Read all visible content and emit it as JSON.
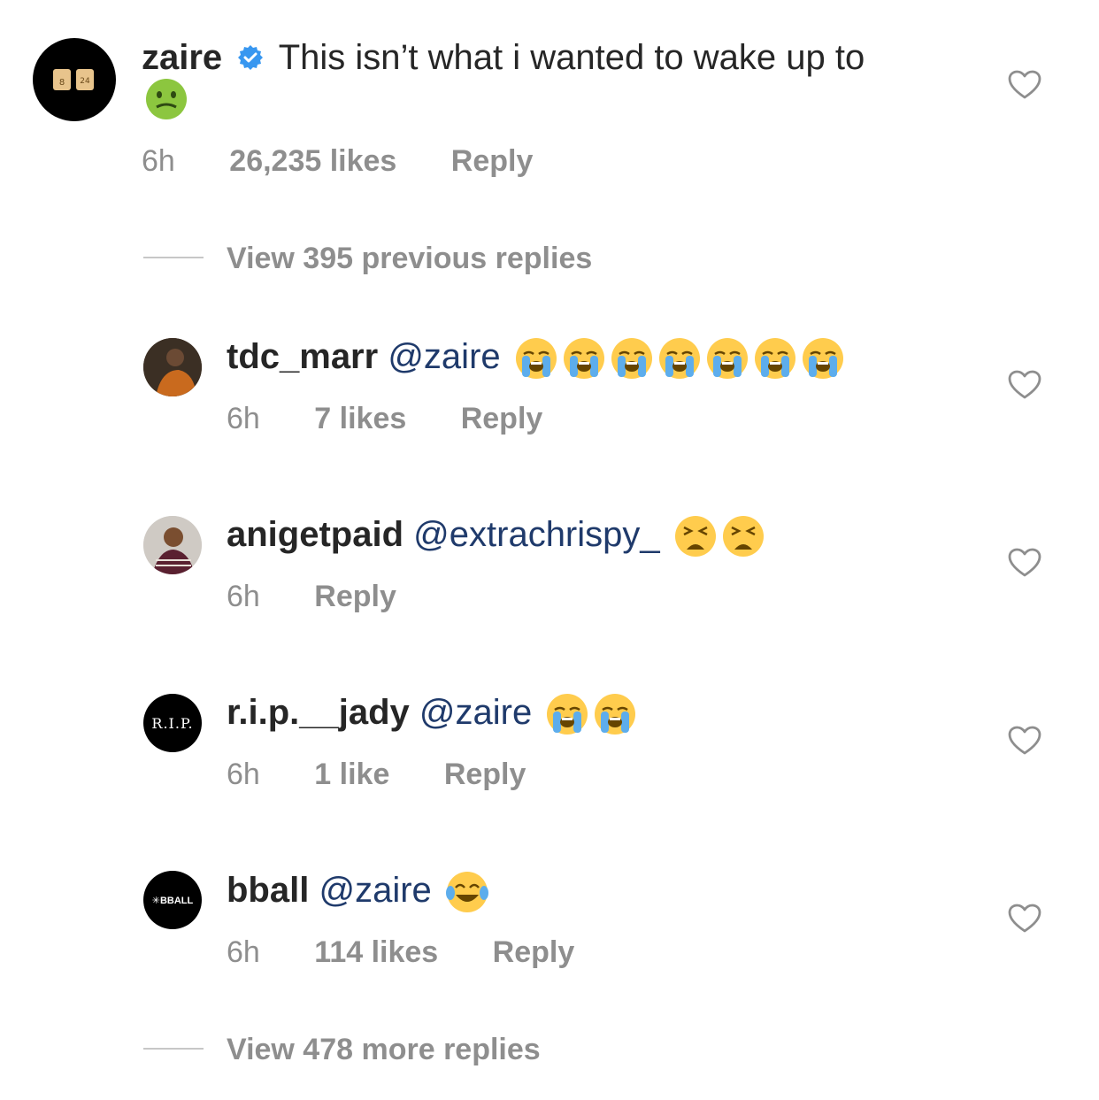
{
  "colors": {
    "username": "#262626",
    "mention": "#1f3a6b",
    "meta": "#8e8e8e",
    "verified": "#3897f0",
    "divider": "#c7c7c7"
  },
  "main_comment": {
    "username": "zaire",
    "verified_icon": "verified-badge-icon",
    "text": "This isn’t what i wanted to wake up to",
    "emoji": "nauseated-face-emoji",
    "time": "6h",
    "likes": "26,235 likes",
    "reply": "Reply",
    "avatar_jersey_numbers": [
      "8",
      "24"
    ]
  },
  "view_previous": "View 395 previous replies",
  "replies": [
    {
      "username": "tdc_marr",
      "mention": "@zaire",
      "emoji": "loudly-crying-face-emoji",
      "emoji_count": 7,
      "time": "6h",
      "likes": "7 likes",
      "reply": "Reply"
    },
    {
      "username": "anigetpaid",
      "mention": "@extrachrispy_",
      "emoji": "weary-face-emoji",
      "emoji_count": 2,
      "time": "6h",
      "likes": "",
      "reply": "Reply"
    },
    {
      "username": "r.i.p.__jady",
      "mention": "@zaire",
      "emoji": "loudly-crying-face-emoji",
      "emoji_count": 2,
      "time": "6h",
      "likes": "1 like",
      "reply": "Reply",
      "avatar_text": "R.I.P."
    },
    {
      "username": "bball",
      "mention": "@zaire",
      "emoji": "face-with-tears-of-joy-emoji",
      "emoji_count": 1,
      "time": "6h",
      "likes": "114 likes",
      "reply": "Reply",
      "avatar_text": "✳BBALL"
    }
  ],
  "view_more": "View 478 more replies"
}
